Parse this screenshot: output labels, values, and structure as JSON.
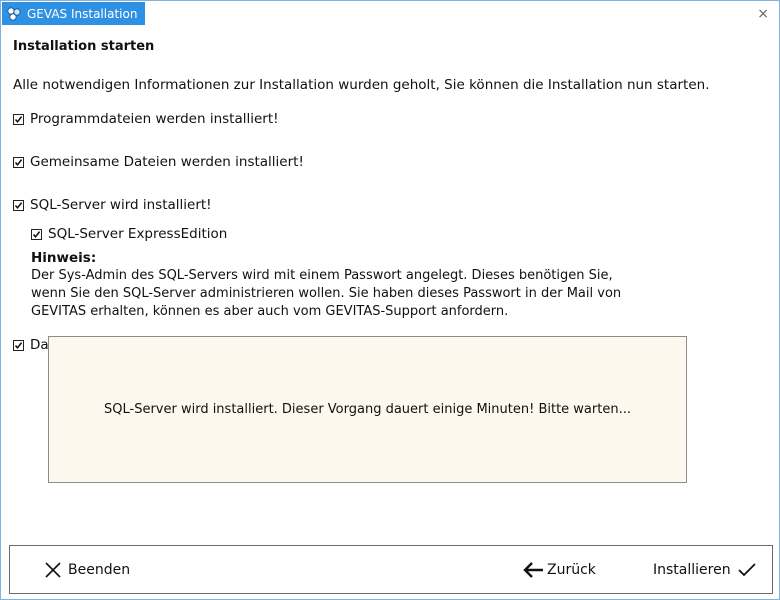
{
  "window": {
    "title": "GEVAS Installation",
    "close_glyph": "×"
  },
  "page": {
    "heading": "Installation starten",
    "intro": "Alle notwendigen Informationen zur Installation wurden geholt, Sie können die Installation nun starten.",
    "checks": [
      {
        "label": "Programmdateien werden installiert!",
        "checked": true
      },
      {
        "label": "Gemeinsame Dateien werden installiert!",
        "checked": true
      },
      {
        "label": "SQL-Server wird installiert!",
        "checked": true
      },
      {
        "label": "SQL-Server ExpressEdition",
        "checked": true
      },
      {
        "label": "Da",
        "checked": true
      }
    ],
    "hint": {
      "title": "Hinweis:",
      "line1": "Der Sys-Admin des SQL-Servers wird mit einem Passwort angelegt. Dieses benötigen Sie,",
      "line2": "wenn Sie den SQL-Server administrieren wollen. Sie haben dieses Passwort in der Mail von",
      "line3": "GEVITAS erhalten, können es aber auch vom GEVITAS-Support anfordern."
    }
  },
  "overlay": {
    "message": "SQL-Server wird installiert. Dieser Vorgang dauert einige Minuten! Bitte warten..."
  },
  "footer": {
    "quit_label": "Beenden",
    "back_label": "Zurück",
    "install_label": "Installieren"
  },
  "colors": {
    "titlebar": "#2f91e3",
    "overlay_bg": "#fdf8ee"
  }
}
